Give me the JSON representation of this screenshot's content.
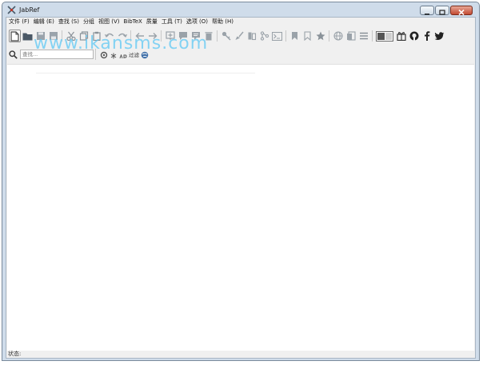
{
  "window": {
    "title": "JabRef",
    "controls": {
      "minimize_icon": "minimize-icon",
      "maximize_icon": "maximize-icon",
      "close_icon": "close-icon"
    }
  },
  "menubar": {
    "items": [
      {
        "label": "文件 (F)"
      },
      {
        "label": "编辑 (E)"
      },
      {
        "label": "查找 (S)"
      },
      {
        "label": "分组"
      },
      {
        "label": "视图 (V)"
      },
      {
        "label": "BibTeX"
      },
      {
        "label": "质量"
      },
      {
        "label": "工具 (T)"
      },
      {
        "label": "选项 (O)"
      },
      {
        "label": "帮助 (H)"
      }
    ]
  },
  "toolbar": {
    "icons": [
      "new-library-icon",
      "open-folder-icon",
      "save-icon",
      "save-all-icon",
      "cut-icon",
      "copy-icon",
      "paste-icon",
      "undo-icon",
      "redo-icon",
      "back-icon",
      "forward-icon",
      "new-entry-icon",
      "new-entry-from-id-icon",
      "comment-icon",
      "delete-icon",
      "key-icon",
      "clean-up-icon",
      "push-icon",
      "merge-icon",
      "terminal-icon",
      "mark-icon",
      "bookmark-icon",
      "star-icon",
      "globe-icon",
      "pdf-icon",
      "list-icon",
      "layout-toggle-icon",
      "gift-icon",
      "github-icon",
      "facebook-icon",
      "twitter-icon"
    ]
  },
  "search": {
    "icon": "search-icon",
    "placeholder": "查找...",
    "options_label": "过滤"
  },
  "watermark": {
    "text": "www.ikansms.com"
  },
  "statusbar": {
    "label": "状态:"
  },
  "colors": {
    "accent": "#1a5fa8",
    "watermark": "#5fc8f5"
  }
}
